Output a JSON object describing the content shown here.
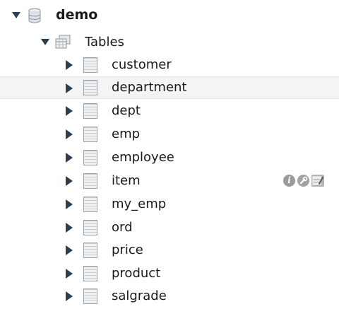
{
  "tree": {
    "schema": {
      "name": "demo",
      "icon": "database-icon",
      "expanded": true
    },
    "group": {
      "label": "Tables",
      "icon": "tables-folder-icon",
      "expanded": true
    },
    "tables": [
      {
        "name": "customer"
      },
      {
        "name": "department",
        "selected": true
      },
      {
        "name": "dept"
      },
      {
        "name": "emp"
      },
      {
        "name": "employee"
      },
      {
        "name": "item",
        "hovered": true
      },
      {
        "name": "my_emp"
      },
      {
        "name": "ord"
      },
      {
        "name": "price"
      },
      {
        "name": "product"
      },
      {
        "name": "salgrade"
      }
    ],
    "row_actions": {
      "info_glyph": "i",
      "icons": [
        "info-icon",
        "wrench-icon",
        "edit-table-icon"
      ]
    }
  },
  "colors": {
    "arrow": "#2c3e50",
    "selected_row": "#f4f4f4",
    "text": "#1a1a1a"
  }
}
